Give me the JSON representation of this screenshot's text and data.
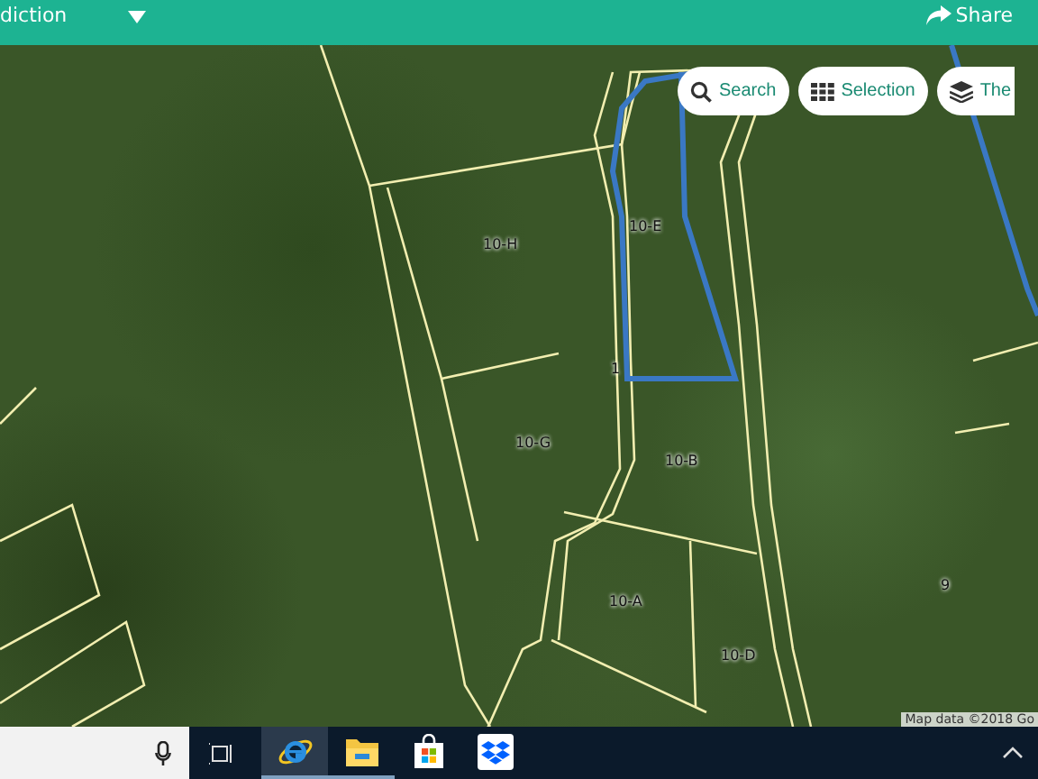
{
  "header": {
    "title": "diction",
    "share": "Share"
  },
  "map_buttons": [
    {
      "kind": "search",
      "label": "Search"
    },
    {
      "kind": "selection",
      "label": "Selection"
    },
    {
      "kind": "layers",
      "label": "The"
    }
  ],
  "map": {
    "parcel_labels": [
      "10-H",
      "10-E",
      "1",
      "10-G",
      "10-B",
      "10-A",
      "10-D",
      "9"
    ],
    "attribution": "Map data ©2018 Go"
  },
  "taskbar": {
    "apps": [
      {
        "kind": "ie",
        "selected": true,
        "running": true
      },
      {
        "kind": "explorer",
        "selected": false,
        "running": true
      },
      {
        "kind": "store",
        "selected": false,
        "running": false
      },
      {
        "kind": "dropbox",
        "selected": false,
        "running": false
      }
    ]
  }
}
